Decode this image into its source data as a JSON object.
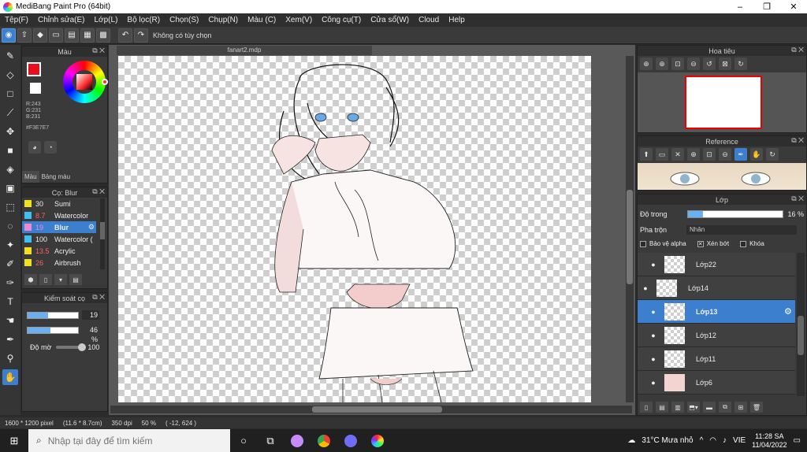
{
  "window": {
    "title": "MediBang Paint Pro (64bit)",
    "minimize": "–",
    "maximize": "❐",
    "close": "✕"
  },
  "menu": [
    "Tệp(F)",
    "Chỉnh sửa(E)",
    "Lớp(L)",
    "Bộ lọc(R)",
    "Chọn(S)",
    "Chụp(N)",
    "Màu (C)",
    "Xem(V)",
    "Công cụ(T)",
    "Cửa sổ(W)",
    "Cloud",
    "Help"
  ],
  "toolbar": {
    "option_text": "Không có tùy chọn"
  },
  "color_panel": {
    "title": "Màu",
    "r": "R:243",
    "g": "G:231",
    "b": "B:231",
    "hex": "#F3E7E7",
    "tab_color": "Màu",
    "tab_palette": "Bảng màu",
    "fg_color": "#e8101e"
  },
  "brush_panel": {
    "title": "Cọ: Blur",
    "items": [
      {
        "size": "30",
        "name": "Sumi",
        "color": "#f0e020"
      },
      {
        "size": "8.7",
        "name": "Watercolor",
        "color": "#40c0f0"
      },
      {
        "size": "19",
        "name": "Blur",
        "color": "#f08ad0"
      },
      {
        "size": "100",
        "name": "Watercolor (",
        "color": "#40c0f0"
      },
      {
        "size": "13.5",
        "name": "Acrylic",
        "color": "#f0e020"
      },
      {
        "size": "26",
        "name": "Airbrush",
        "color": "#f0e020"
      }
    ]
  },
  "control_panel": {
    "title": "Kiểm soát cọ",
    "size_value": "19",
    "size_fill": 0.4,
    "percent_value": "46 %",
    "percent_fill": 0.46,
    "opacity_label": "Độ mờ",
    "opacity_value": "100"
  },
  "canvas": {
    "doc_name": "fanart2.mdp"
  },
  "status": {
    "size": "1600 * 1200 pixel",
    "cm": "(11.6 * 8.7cm)",
    "dpi": "350 dpi",
    "zoom": "50 %",
    "coords": "( -12, 624 )"
  },
  "navigator": {
    "title": "Hoa tiêu"
  },
  "reference": {
    "title": "Reference"
  },
  "layer_panel": {
    "title": "Lớp",
    "opacity_label": "Độ trong",
    "opacity_value": "16 %",
    "opacity_fill": 0.16,
    "blend_label": "Pha trộn",
    "blend_value": "Nhân",
    "protect_alpha": "Bảo vệ alpha",
    "clipping": "Xén bớt",
    "lock": "Khóa",
    "clipping_checked": "✕",
    "layers": [
      {
        "name": "Lớp22"
      },
      {
        "name": "Lớp14"
      },
      {
        "name": "Lớp13"
      },
      {
        "name": "Lớp12"
      },
      {
        "name": "Lớp11"
      },
      {
        "name": "Lớp6"
      }
    ]
  },
  "taskbar": {
    "search_placeholder": "Nhập tại đây để tìm kiếm",
    "weather": "31°C Mưa nhỏ",
    "lang": "VIE",
    "time": "11:28 SA",
    "date": "11/04/2022"
  }
}
